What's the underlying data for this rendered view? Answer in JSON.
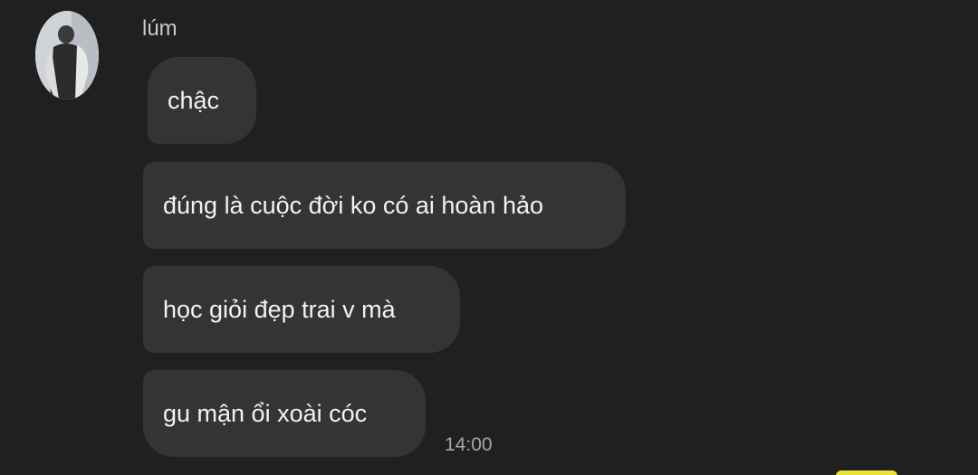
{
  "sender": {
    "name": "lúm"
  },
  "messages": [
    {
      "text": "chậc"
    },
    {
      "text": "đúng là cuộc đời ko có ai hoàn hảo"
    },
    {
      "text": "học giỏi đẹp trai v mà"
    },
    {
      "text": "gu mận ổi xoài cóc"
    }
  ],
  "timestamp": "14:00",
  "colors": {
    "background": "#202020",
    "bubble": "#343434",
    "text": "#f2f2f2",
    "accent_yellow": "#e8e23a"
  }
}
